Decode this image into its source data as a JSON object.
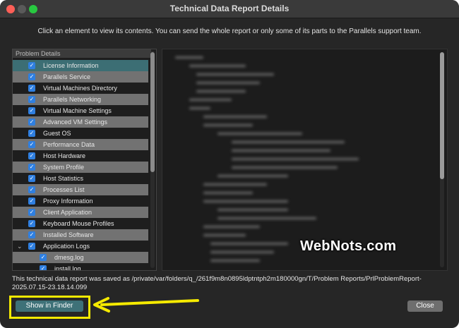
{
  "window": {
    "title": "Technical Data Report Details"
  },
  "instruction": "Click an element to view its contents. You can send the whole report or only some of its parts to the Parallels support team.",
  "tree": {
    "header": "Problem Details",
    "items": [
      {
        "label": "License Information",
        "checked": true
      },
      {
        "label": "Parallels Service",
        "checked": true
      },
      {
        "label": "Virtual Machines Directory",
        "checked": true
      },
      {
        "label": "Parallels Networking",
        "checked": true
      },
      {
        "label": "Virtual Machine Settings",
        "checked": true
      },
      {
        "label": "Advanced VM Settings",
        "checked": true
      },
      {
        "label": "Guest OS",
        "checked": true
      },
      {
        "label": "Performance Data",
        "checked": true
      },
      {
        "label": "Host Hardware",
        "checked": true
      },
      {
        "label": "System Profile",
        "checked": true
      },
      {
        "label": "Host Statistics",
        "checked": true
      },
      {
        "label": "Processes List",
        "checked": true
      },
      {
        "label": "Proxy Information",
        "checked": true
      },
      {
        "label": "Client Application",
        "checked": true
      },
      {
        "label": "Keyboard Mouse Profiles",
        "checked": true
      },
      {
        "label": "Installed Software",
        "checked": true
      },
      {
        "label": "Application Logs",
        "checked": true,
        "expanded": true
      },
      {
        "label": "dmesg.log",
        "checked": true
      },
      {
        "label": "install.log",
        "checked": true
      }
    ]
  },
  "watermark": "WebNots.com",
  "saved_message": "This technical data report was saved as /private/var/folders/q_/261f9m8n0895ldptntph2m180000gn/T/Problem Reports/PrlProblemReport-2025.07.15-23.18.14.099",
  "buttons": {
    "show_in_finder": "Show in Finder",
    "close": "Close"
  },
  "colors": {
    "accent": "#3e7178",
    "checkbox": "#2f7fe0",
    "annotation": "#f5ea00"
  }
}
